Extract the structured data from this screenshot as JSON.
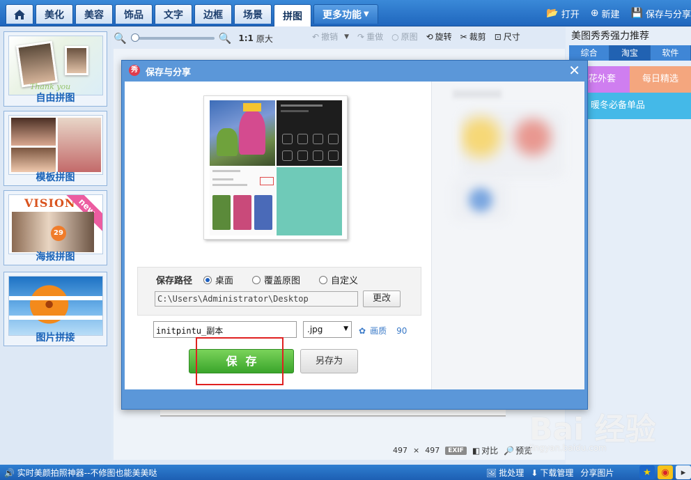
{
  "top_tabs": [
    "美化",
    "美容",
    "饰品",
    "文字",
    "边框",
    "场景",
    "拼图"
  ],
  "top_tabs_more": "更多功能",
  "top_actions": {
    "open": "打开",
    "new": "新建",
    "save_share": "保存与分享"
  },
  "sidebar": {
    "items": [
      {
        "label": "自由拼图"
      },
      {
        "label": "模板拼图"
      },
      {
        "label": "海报拼图",
        "thumb_title": "VISION",
        "ribbon": "new",
        "badge": "29"
      },
      {
        "label": "图片拼接"
      }
    ],
    "thumb_text": "Thank you"
  },
  "toolbar": {
    "ratio": "1:1",
    "original_size": "原大",
    "undo": "撤销",
    "redo": "重做",
    "original": "原图",
    "rotate": "旋转",
    "crop": "裁剪",
    "size": "尺寸"
  },
  "right_panel": {
    "title": "美图秀秀强力推荐",
    "tabs": [
      "综合",
      "淘宝",
      "软件"
    ],
    "active_tab": "淘宝",
    "promo_a": "心花外套",
    "promo_b": "每日精选",
    "promo_c": "暖冬必备单品"
  },
  "dialog": {
    "title": "保存与分享",
    "logo": "秀",
    "path_label": "保存路径",
    "radio_options": [
      "桌面",
      "覆盖原图",
      "自定义"
    ],
    "selected_radio": "桌面",
    "path_value": "C:\\Users\\Administrator\\Desktop",
    "change_button": "更改",
    "filename": "initpintu_副本",
    "format": ".jpg",
    "quality_label": "画质",
    "quality_value": "90",
    "save_button": "保存",
    "save_as_button": "另存为"
  },
  "canvas_info": {
    "width": "497",
    "x": "×",
    "height": "497",
    "exif": "EXIF",
    "compare": "对比",
    "preview": "预览"
  },
  "statusbar": {
    "ticker": "实时美颜拍照神器--不修图也能美美哒",
    "batch": "批处理",
    "download": "下载管理",
    "share": "分享图片"
  },
  "watermark": {
    "logo": "Bai 经验",
    "url": "jingyan.baidu.com"
  },
  "colors": {
    "accent": "#2a6fc6",
    "save_green": "#3aa52b",
    "highlight_red": "#e02020"
  }
}
